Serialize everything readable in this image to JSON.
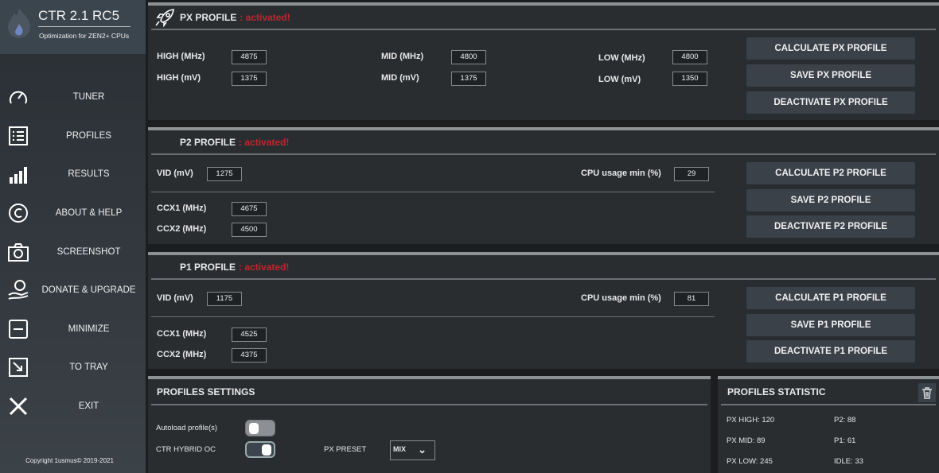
{
  "app": {
    "title": "CTR 2.1 RC5",
    "subtitle": "Optimization for ZEN2+ CPUs",
    "copyright": "Copyright 1usmus© 2019-2021"
  },
  "nav": [
    "TUNER",
    "PROFILES",
    "RESULTS",
    "ABOUT & HELP",
    "SCREENSHOT",
    "DONATE & UPGRADE",
    "MINIMIZE",
    "TO TRAY",
    "EXIT"
  ],
  "px": {
    "title": "PX PROFILE",
    "status": ": activated!",
    "high_mhz_label": "HIGH (MHz)",
    "high_mhz": "4875",
    "high_mv_label": "HIGH  (mV)",
    "high_mv": "1375",
    "mid_mhz_label": "MID (MHz)",
    "mid_mhz": "4800",
    "mid_mv_label": "MID (mV)",
    "mid_mv": "1375",
    "low_mhz_label": "LOW (MHz)",
    "low_mhz": "4800",
    "low_mv_label": "LOW (mV)",
    "low_mv": "1350",
    "calc": "CALCULATE PX PROFILE",
    "save": "SAVE PX PROFILE",
    "deact": "DEACTIVATE PX PROFILE"
  },
  "p2": {
    "title": "P2 PROFILE",
    "status": ": activated!",
    "vid_label": "VID (mV)",
    "vid": "1275",
    "cpu_label": "CPU usage min (%)",
    "cpu": "29",
    "ccx1_label": "CCX1 (MHz)",
    "ccx1": "4675",
    "ccx2_label": "CCX2 (MHz)",
    "ccx2": "4500",
    "calc": "CALCULATE P2 PROFILE",
    "save": "SAVE P2 PROFILE",
    "deact": "DEACTIVATE P2 PROFILE"
  },
  "p1": {
    "title": "P1 PROFILE",
    "status": ": activated!",
    "vid_label": "VID (mV)",
    "vid": "1175",
    "cpu_label": "CPU usage min (%)",
    "cpu": "81",
    "ccx1_label": "CCX1 (MHz)",
    "ccx1": "4525",
    "ccx2_label": "CCX2 (MHz)",
    "ccx2": "4375",
    "calc": "CALCULATE P1 PROFILE",
    "save": "SAVE P1 PROFILE",
    "deact": "DEACTIVATE P1 PROFILE"
  },
  "settings": {
    "title": "PROFILES SETTINGS",
    "autoload": "Autoload profile(s)",
    "autoload_on": false,
    "hybrid": "CTR HYBRID OC",
    "hybrid_on": true,
    "preset_label": "PX PRESET",
    "preset": "MIX"
  },
  "stats": {
    "title": "PROFILES STATISTIC",
    "px_high": "PX HIGH: 120",
    "px_mid": "PX MID: 89",
    "px_low": "PX LOW: 245",
    "p2": "P2: 88",
    "p1": "P1: 61",
    "idle": "IDLE: 33"
  },
  "colors": {
    "accent_red": "#c0262c"
  }
}
